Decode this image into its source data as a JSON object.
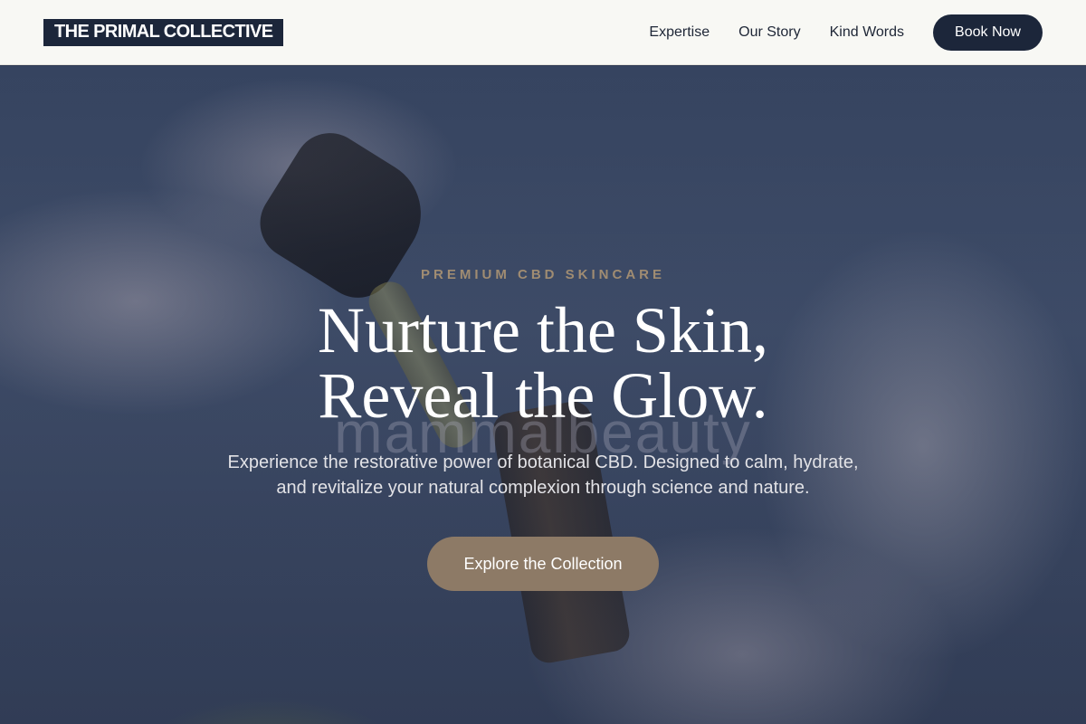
{
  "header": {
    "logo": "THE PRIMAL COLLECTIVE",
    "nav": [
      "Expertise",
      "Our Story",
      "Kind Words"
    ],
    "cta_label": "Book Now"
  },
  "hero": {
    "eyebrow": "PREMIUM CBD SKINCARE",
    "headline_line1": "Nurture the Skin,",
    "headline_line2": "Reveal the Glow.",
    "watermark": "mammalbeauty",
    "subtext": "Experience the restorative power of botanical CBD. Designed to calm, hydrate, and revitalize your natural complexion through science and nature.",
    "cta_label": "Explore the Collection"
  },
  "colors": {
    "navy": "#1c263a",
    "accent_tan": "#8d7a66",
    "header_bg": "#f8f8f4"
  }
}
